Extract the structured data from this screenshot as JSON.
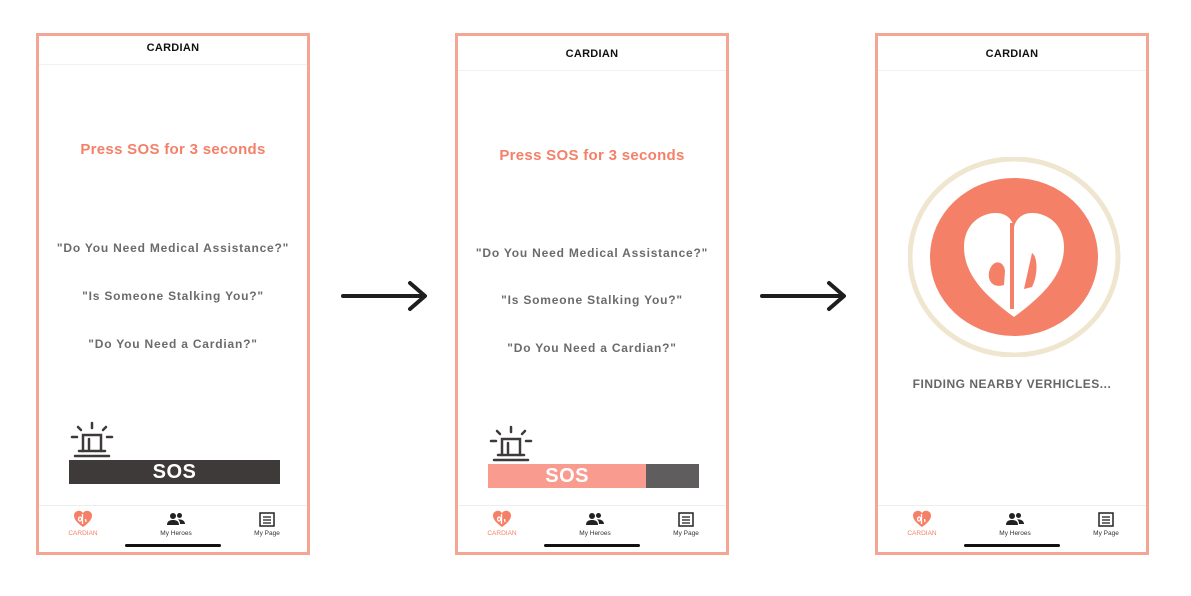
{
  "screens": [
    {
      "title": "CARDIAN",
      "prompt": "Press SOS for 3 seconds",
      "questions": [
        "\"Do You Need Medical Assistance?\"",
        "\"Is Someone Stalking You?\"",
        "\"Do You Need a Cardian?\""
      ],
      "sos_label": "SOS",
      "sos_progress": 0,
      "tabs": [
        "CARDIAN",
        "My Heroes",
        "My Page"
      ]
    },
    {
      "title": "CARDIAN",
      "prompt": "Press SOS for 3 seconds",
      "questions": [
        "\"Do You Need Medical Assistance?\"",
        "\"Is Someone Stalking You?\"",
        "\"Do You Need a Cardian?\""
      ],
      "sos_label": "SOS",
      "sos_progress": 0.75,
      "tabs": [
        "CARDIAN",
        "My Heroes",
        "My Page"
      ]
    },
    {
      "title": "CARDIAN",
      "status": "FINDING NEARBY VERHICLES...",
      "tabs": [
        "CARDIAN",
        "My Heroes",
        "My Page"
      ]
    }
  ],
  "colors": {
    "accent": "#f58068",
    "frame": "#f4a594",
    "sos_dark": "#3f3a3a",
    "sos_fill": "#f99b8f",
    "sos_track": "#5f5d5d",
    "ring": "#f0e6cf"
  },
  "icons": {
    "siren": "siren-icon",
    "heart": "cardian-heart-icon",
    "heroes": "people-icon",
    "page": "list-page-icon",
    "arrow": "right-arrow-icon"
  }
}
